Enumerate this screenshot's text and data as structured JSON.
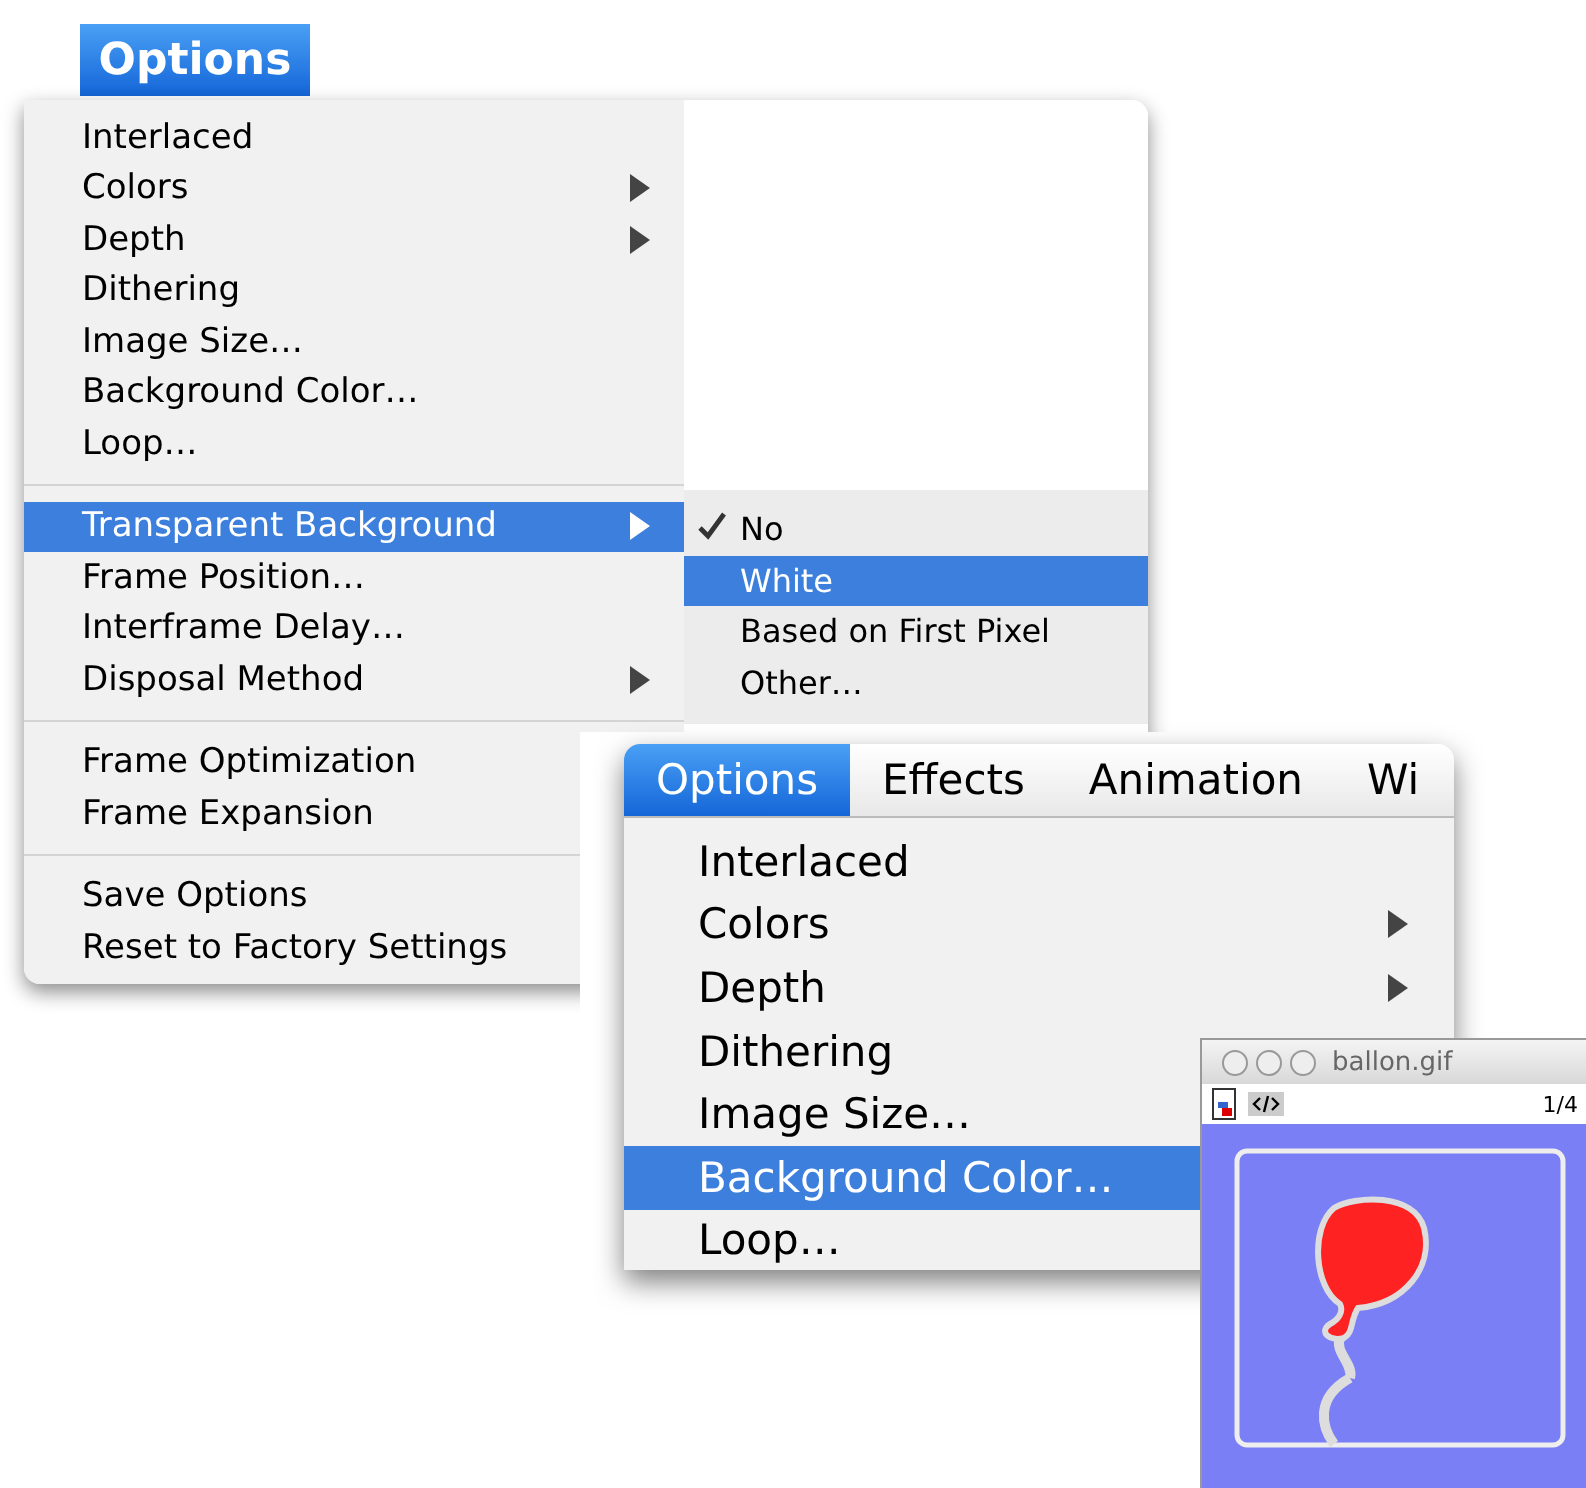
{
  "main_menu": {
    "title": "Options",
    "items": [
      {
        "kind": "item",
        "label": "Interlaced",
        "selected": false
      },
      {
        "kind": "submenu",
        "label": "Colors",
        "selected": false
      },
      {
        "kind": "submenu",
        "label": "Depth",
        "selected": false
      },
      {
        "kind": "item",
        "label": "Dithering",
        "selected": false
      },
      {
        "kind": "item",
        "label": "Image Size…",
        "selected": false
      },
      {
        "kind": "item",
        "label": "Background Color…",
        "selected": false
      },
      {
        "kind": "item",
        "label": "Loop…",
        "selected": false
      },
      {
        "kind": "separator"
      },
      {
        "kind": "submenu",
        "label": "Transparent Background",
        "selected": true
      },
      {
        "kind": "item",
        "label": "Frame Position…",
        "selected": false
      },
      {
        "kind": "item",
        "label": "Interframe Delay…",
        "selected": false
      },
      {
        "kind": "submenu",
        "label": "Disposal Method",
        "selected": false
      },
      {
        "kind": "separator"
      },
      {
        "kind": "item",
        "label": "Frame Optimization",
        "selected": false
      },
      {
        "kind": "item",
        "label": "Frame Expansion",
        "selected": false
      },
      {
        "kind": "separator"
      },
      {
        "kind": "item",
        "label": "Save Options",
        "selected": false
      },
      {
        "kind": "item",
        "label": "Reset to Factory Settings",
        "selected": false
      }
    ],
    "submenu": [
      {
        "label": "No",
        "checked": true,
        "selected": false
      },
      {
        "label": "White",
        "checked": false,
        "selected": true
      },
      {
        "label": "Based on First Pixel",
        "checked": false,
        "selected": false
      },
      {
        "label": "Other…",
        "checked": false,
        "selected": false
      }
    ]
  },
  "second_menu": {
    "menubar": [
      {
        "label": "Options",
        "selected": true
      },
      {
        "label": "Effects",
        "selected": false
      },
      {
        "label": "Animation",
        "selected": false
      },
      {
        "label": "Wi",
        "selected": false
      }
    ],
    "items": [
      {
        "kind": "item",
        "label": "Interlaced",
        "selected": false
      },
      {
        "kind": "submenu",
        "label": "Colors",
        "selected": false
      },
      {
        "kind": "submenu",
        "label": "Depth",
        "selected": false
      },
      {
        "kind": "item",
        "label": "Dithering",
        "selected": false
      },
      {
        "kind": "item",
        "label": "Image Size…",
        "selected": false
      },
      {
        "kind": "item",
        "label": "Background Color…",
        "selected": true
      },
      {
        "kind": "item",
        "label": "Loop…",
        "selected": false
      }
    ]
  },
  "image_window": {
    "title": "ballon.gif",
    "frame_counter": "1/4"
  }
}
